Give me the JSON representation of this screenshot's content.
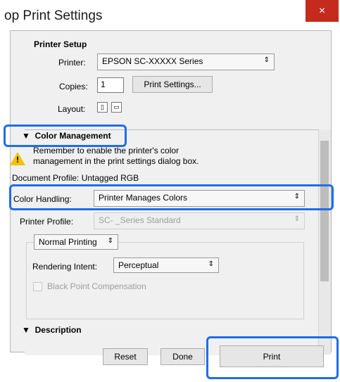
{
  "window": {
    "title": "op Print Settings",
    "close_glyph": "×"
  },
  "printer_setup": {
    "heading": "Printer Setup",
    "printer_label": "Printer:",
    "printer_value": "EPSON SC-XXXXX Series",
    "copies_label": "Copies:",
    "copies_value": "1",
    "print_settings_button": "Print Settings...",
    "layout_label": "Layout:"
  },
  "color_management": {
    "heading": "Color Management",
    "warning_line1": "Remember to enable the printer's color",
    "warning_line2": "management in the print settings dialog box.",
    "document_profile": "Document Profile: Untagged RGB",
    "color_handling_label": "Color Handling:",
    "color_handling_value": "Printer Manages Colors",
    "printer_profile_label": "Printer Profile:",
    "printer_profile_value": "SC-        _Series Standard",
    "normal_printing": "Normal Printing",
    "rendering_intent_label": "Rendering Intent:",
    "rendering_intent_value": "Perceptual",
    "black_point": "Black Point Compensation"
  },
  "description": {
    "heading": "Description"
  },
  "buttons": {
    "reset": "Reset",
    "done": "Done",
    "print": "Print"
  },
  "colors": {
    "highlight": "#1e6ee8",
    "close_bg": "#c42b1c"
  }
}
